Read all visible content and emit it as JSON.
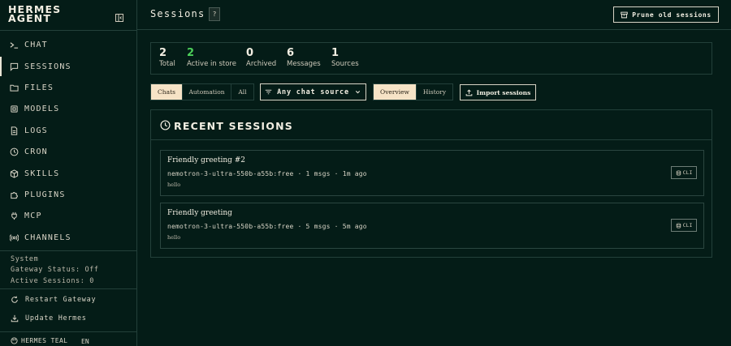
{
  "sidebar": {
    "brand": "HERMES AGENT",
    "nav": [
      {
        "label": "CHAT",
        "icon": "terminal-icon"
      },
      {
        "label": "SESSIONS",
        "icon": "message-square-icon"
      },
      {
        "label": "FILES",
        "icon": "folder-icon"
      },
      {
        "label": "MODELS",
        "icon": "cpu-icon"
      },
      {
        "label": "LOGS",
        "icon": "file-text-icon"
      },
      {
        "label": "CRON",
        "icon": "clock-icon"
      },
      {
        "label": "SKILLS",
        "icon": "package-icon"
      },
      {
        "label": "PLUGINS",
        "icon": "puzzle-icon"
      },
      {
        "label": "MCP",
        "icon": "plug-icon"
      },
      {
        "label": "CHANNELS",
        "icon": "radio-icon"
      }
    ],
    "active_nav": "SESSIONS",
    "system": {
      "heading": "System",
      "gateway_status": "Gateway Status: Off",
      "active_sessions": "Active Sessions: 0"
    },
    "actions": {
      "restart": "Restart Gateway",
      "update": "Update Hermes"
    },
    "footer": {
      "theme": "HERMES TEAL",
      "language": "EN"
    }
  },
  "header": {
    "title": "Sessions",
    "help": "?",
    "prune_label": "Prune old sessions"
  },
  "stats": [
    {
      "value": "2",
      "label": "Total",
      "accent": false
    },
    {
      "value": "2",
      "label": "Active in store",
      "accent": true
    },
    {
      "value": "0",
      "label": "Archived",
      "accent": false
    },
    {
      "value": "6",
      "label": "Messages",
      "accent": false
    },
    {
      "value": "1",
      "label": "Sources",
      "accent": false
    }
  ],
  "filters": {
    "kind_tabs": [
      "Chats",
      "Automation",
      "All"
    ],
    "kind_selected": "Chats",
    "source_select": "Any chat source",
    "view_tabs": [
      "Overview",
      "History"
    ],
    "view_selected": "Overview",
    "import_label": "Import sessions"
  },
  "recent": {
    "title": "RECENT SESSIONS",
    "sessions": [
      {
        "title": "Friendly greeting #2",
        "meta": "nemotron-3-ultra-550b-a55b:free · 1 msgs · 1m ago",
        "preview": "hello",
        "source": "CLI"
      },
      {
        "title": "Friendly greeting",
        "meta": "nemotron-3-ultra-550b-a55b:free · 5 msgs · 5m ago",
        "preview": "hello",
        "source": "CLI"
      }
    ]
  },
  "colors": {
    "background": "#041c17",
    "border": "#23403a",
    "text": "#e8e4d6",
    "accent_green": "#4ccf5a",
    "selected_tab_bg": "#f6e3c6"
  }
}
